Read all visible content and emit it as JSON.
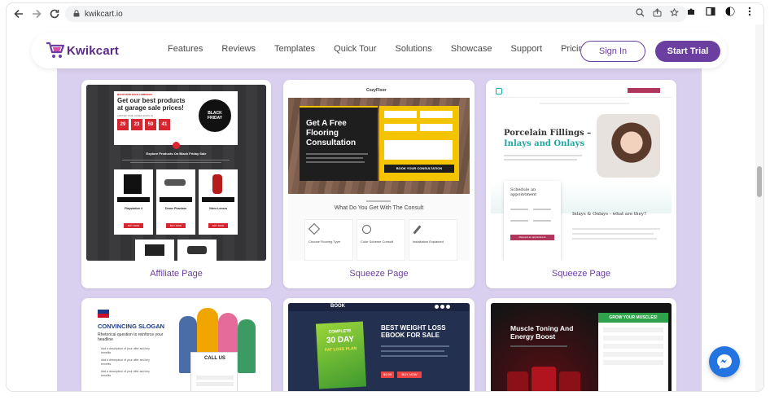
{
  "browser": {
    "url": "kwikcart.io"
  },
  "site": {
    "brand": "Kwikcart",
    "menu": [
      "Features",
      "Reviews",
      "Templates",
      "Quick Tour",
      "Solutions",
      "Showcase",
      "Support",
      "Pricing"
    ],
    "signin_label": "Sign In",
    "trial_label": "Start Trial"
  },
  "cards": {
    "affiliate": {
      "caption": "Affiliate Page",
      "promo_badge": "BACKYARD SALE CAMPAIGN",
      "headline": "Get our best products at garage sale prices!",
      "sub": "LIMITED TIME OFFER ENDS IN",
      "timer": [
        "29",
        "23",
        "59",
        "41"
      ],
      "black_friday": "BLACK FRIDAY",
      "section_title": "Explore Products On Black Friday Sale",
      "products": [
        "Playstation 4",
        "Drone Phantom",
        "Video Lenses"
      ],
      "buy": "BUY NOW"
    },
    "squeeze1": {
      "caption": "Squeeze Page",
      "logo": "CozyFloor",
      "headline": "Get A Free Flooring Consultation",
      "cta": "BOOK YOUR CONSULTATION",
      "section_title": "What Do You Get With The Consult",
      "features": [
        "Choose Flooring Type",
        "Color Scheme Consult",
        "Installation Explained"
      ]
    },
    "squeeze2": {
      "caption": "Squeeze Page",
      "headline1": "Porcelain Fillings –",
      "headline2": "Inlays and Onlays",
      "schedule": "Schedule an appointment",
      "sub_heading": "Inlays & Onlays - what are they?",
      "cta": "Request an appointment"
    },
    "convincing": {
      "headline": "CONVINCING SLOGAN",
      "sub": "Rhetorical question to reinforce your headline",
      "bullets": [
        "Add a description of your offer and key benefits",
        "Add a description of your offer and key benefits",
        "Add a description of your offer and key benefits"
      ],
      "callus": "CALL US"
    },
    "book": {
      "brand": "BOOK",
      "headline": "BEST WEIGHT LOSS EBOOK FOR SALE",
      "cover_top": "COMPLETE",
      "cover_days": "30 DAY",
      "cover_plan": "FAT LOSS PLAN",
      "cta1": "$9.99",
      "cta2": "BUY NOW"
    },
    "muscle": {
      "headline": "Muscle Toning And Energy Boost",
      "form_title": "GROW YOUR MUSCLES!"
    }
  },
  "colors": {
    "brand_purple": "#6b3fa0",
    "lilac": "#d9cfee",
    "messenger_blue": "#2374e1"
  }
}
